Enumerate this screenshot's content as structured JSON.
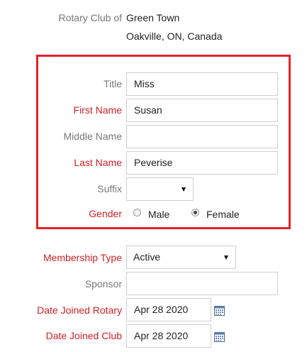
{
  "club": {
    "label": "Rotary Club of",
    "name": "Green Town",
    "location": "Oakville, ON, Canada"
  },
  "personal": {
    "title": {
      "label": "Title",
      "value": "Miss"
    },
    "first_name": {
      "label": "First Name",
      "value": "Susan"
    },
    "middle_name": {
      "label": "Middle Name",
      "value": ""
    },
    "last_name": {
      "label": "Last Name",
      "value": "Peverise"
    },
    "suffix": {
      "label": "Suffix",
      "value": ""
    },
    "gender": {
      "label": "Gender",
      "options": [
        "Male",
        "Female"
      ],
      "selected": "Female"
    }
  },
  "membership": {
    "type": {
      "label": "Membership Type",
      "value": "Active"
    },
    "sponsor": {
      "label": "Sponsor",
      "value": ""
    },
    "date_joined_rotary": {
      "label": "Date Joined Rotary",
      "value": "Apr 28 2020"
    },
    "date_joined_club": {
      "label": "Date Joined Club",
      "value": "Apr 28 2020"
    }
  },
  "colors": {
    "required_label": "#d42027",
    "muted_label": "#777777",
    "highlight_border": "#e4222b"
  },
  "icons": [
    "calendar-icon",
    "chevron-down-icon",
    "radio-icon"
  ]
}
